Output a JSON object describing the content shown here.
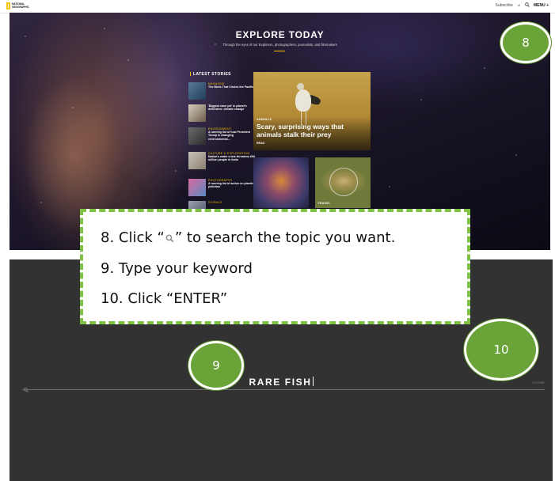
{
  "top_screenshot": {
    "logo_text": "NATIONAL GEOGRAPHIC",
    "nav": {
      "subscribe": "Subscribe",
      "menu": "MENU +"
    },
    "hero": {
      "title": "EXPLORE TODAY",
      "subtitle": "Through the eyes of our Explorers, photographers, journalists, and filmmakers"
    },
    "latest": {
      "heading": "LATEST STORIES",
      "stories": [
        {
          "category": "MAGAZINE",
          "title": "The Birds That Circled the Pacific"
        },
        {
          "category": "",
          "title": "'Biggest case yet' in planet's defenders: climate change"
        },
        {
          "category": "ENVIRONMENT",
          "title": "A running list of how President Trump is changing environmental..."
        },
        {
          "category": "CULTURE & EXPLORATION",
          "title": "Nation's water crisis threatens 600 million people in India"
        },
        {
          "category": "PHOTOGRAPHY",
          "title": "A running list of action on plastic pollution"
        },
        {
          "category": "SCIENCE",
          "title": ""
        }
      ]
    },
    "feature": {
      "category": "ANIMALS",
      "title": "Scary, surprising ways that animals stalk their prey",
      "read": "READ"
    },
    "card3_label": "TRAVEL"
  },
  "instructions": {
    "step8_before": "8. Click “",
    "step8_after": "” to search the topic you want.",
    "step9": "9. Type your keyword",
    "step10": "10. Click “ENTER”"
  },
  "bottom_screenshot": {
    "search_value": "RARE FISH",
    "close_label": "CLOSE"
  },
  "badges": {
    "b8": "8",
    "b9": "9",
    "b10": "10"
  },
  "colors": {
    "badge_green": "#6aa338",
    "dash_green": "#7dc242",
    "ng_yellow": "#f6c600",
    "overlay_dark": "#323232"
  }
}
